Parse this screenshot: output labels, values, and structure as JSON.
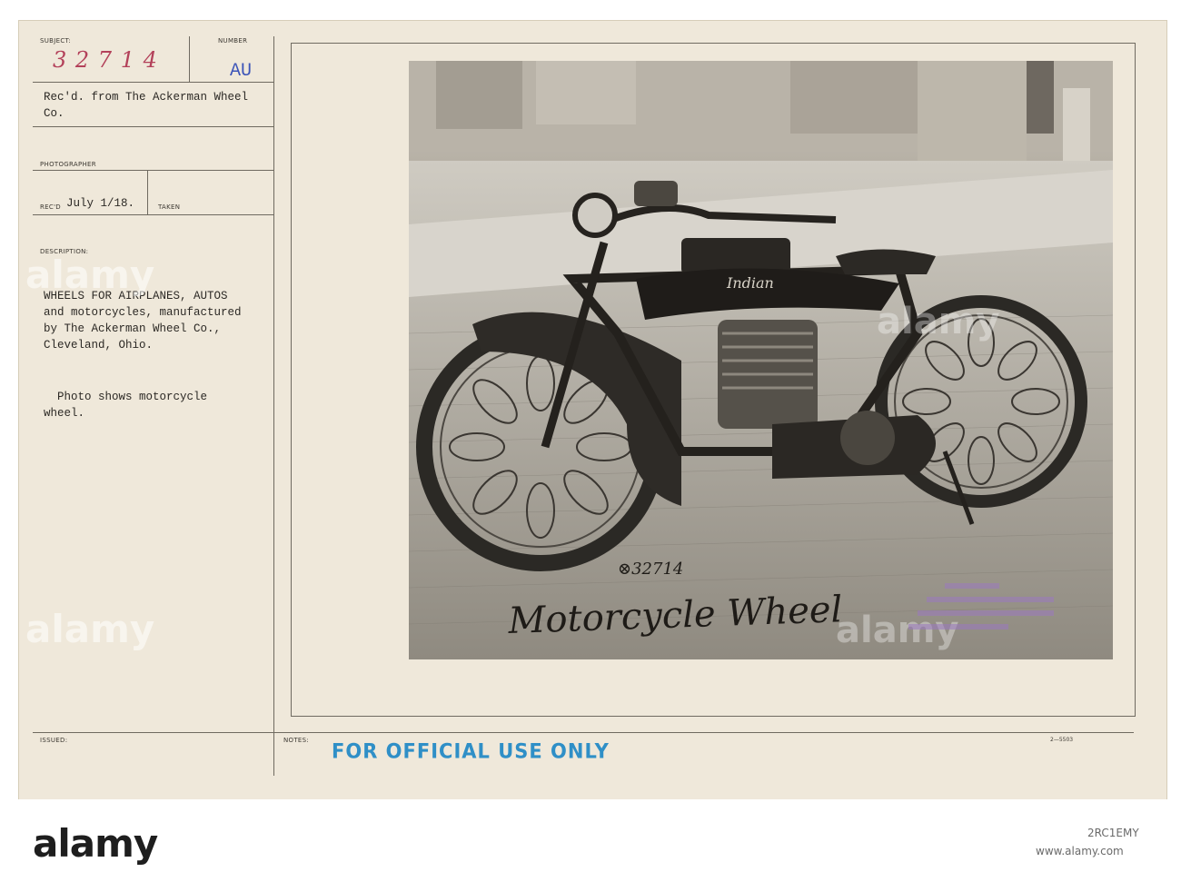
{
  "card": {
    "subject_label": "SUBJECT:",
    "subject_value": "3 2 7 1 4",
    "number_label": "NUMBER",
    "number_value": "AU",
    "received_from": "Rec'd. from The Ackerman Wheel\nCo.",
    "photographer_label": "PHOTOGRAPHER",
    "recd_label": "REC'D",
    "recd_value": "July 1/18.",
    "taken_label": "TAKEN",
    "description_label": "DESCRIPTION:",
    "description_text": "WHEELS FOR AIRPLANES, AUTOS\nand motorcycles, manufactured\nby The Ackerman Wheel Co.,\nCleveland, Ohio.",
    "photo_note": "  Photo shows motorcycle\nwheel.",
    "issued_label": "ISSUED:",
    "notes_label": "NOTES:",
    "stamp": "FOR OFFICIAL USE ONLY",
    "form_code": "2—5503"
  },
  "photo": {
    "caption_number": "⊗32714",
    "caption_hand": "Motorcycle Wheel",
    "tank_script": "Indian"
  },
  "watermarks": {
    "brand": "alamy"
  },
  "footer": {
    "logo": "alamy",
    "image_id": "2RC1EMY",
    "url": "www.alamy.com"
  },
  "colors": {
    "card_bg": "#efe8da",
    "stamp_blue": "#2f8fc7",
    "ink_red": "#b3415a"
  }
}
